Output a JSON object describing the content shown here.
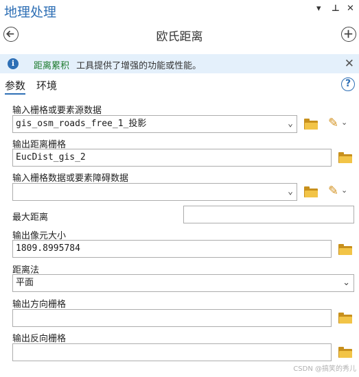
{
  "window": {
    "title": "地理处理",
    "dropdown_glyph": "▾",
    "pin_glyph": "⊥",
    "close_glyph": "✕"
  },
  "nav": {
    "tool_title": "欧氏距离",
    "back_icon": "arrow-left-circle",
    "add_icon": "plus-circle"
  },
  "info_bar": {
    "icon_glyph": "i",
    "link_text": "距离累积",
    "message": "工具提供了增强的功能或性能。",
    "close_glyph": "✕"
  },
  "tabs": [
    {
      "label": "参数",
      "active": true
    },
    {
      "label": "环境",
      "active": false
    }
  ],
  "help_glyph": "?",
  "combo_glyph": "⌄",
  "pencil_glyph": "✎",
  "params": {
    "input_raster": {
      "label": "输入栅格或要素源数据",
      "value": "gis_osm_roads_free_1_投影"
    },
    "output_distance": {
      "label": "输出距离栅格",
      "value": "EucDist_gis_2"
    },
    "barrier": {
      "label": "输入栅格数据或要素障碍数据",
      "value": ""
    },
    "max_distance": {
      "label": "最大距离",
      "value": ""
    },
    "cell_size": {
      "label": "输出像元大小",
      "value": "1809.8995784"
    },
    "distance_method": {
      "label": "距离法",
      "value": "平面"
    },
    "direction_raster": {
      "label": "输出方向栅格",
      "value": ""
    },
    "back_direction_raster": {
      "label": "输出反向栅格",
      "value": ""
    }
  },
  "watermark": "CSDN @搞笑的秀儿",
  "colors": {
    "accent": "#2e6fb5",
    "info_bg": "#e4f0fb",
    "info_link": "#1c7a2c",
    "folder": "#f2c447"
  }
}
